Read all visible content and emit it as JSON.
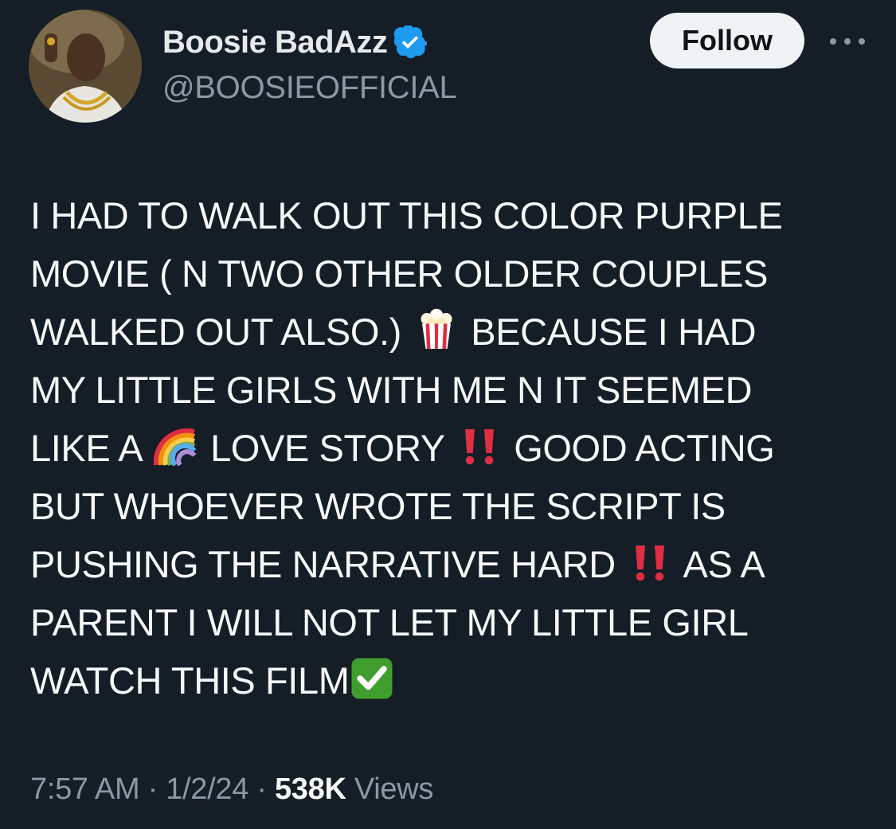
{
  "author": {
    "display_name": "Boosie BadAzz",
    "handle": "@BOOSIEOFFICIAL",
    "verified": true,
    "avatar_icon": "profile-photo"
  },
  "actions": {
    "follow_label": "Follow",
    "more_icon": "ellipsis-icon"
  },
  "tweet": {
    "segments": [
      "I HAD TO WALK OUT THIS COLOR PURPLE",
      "MOVIE ( N TWO OTHER OLDER COUPLES",
      "WALKED OUT ALSO.)",
      "BECAUSE I HAD",
      "MY LITTLE GIRLS WITH ME N IT SEEMED",
      "LIKE A",
      "LOVE STORY",
      "GOOD ACTING",
      "BUT WHOEVER WROTE THE SCRIPT IS",
      "PUSHING THE NARRATIVE HARD",
      "AS A",
      "PARENT I WILL NOT LET MY LITTLE GIRL",
      "WATCH THIS FILM"
    ],
    "emojis": [
      "popcorn",
      "rainbow",
      "double-exclamation",
      "double-exclamation",
      "check-mark-button"
    ]
  },
  "meta": {
    "time": "7:57 AM",
    "separator": "·",
    "date": "1/2/24",
    "views_count": "538K",
    "views_label": "Views"
  },
  "colors": {
    "background": "#151d27",
    "text": "#f7f9f9",
    "secondary_text": "#8b98a5",
    "verified_blue": "#1d9bf0",
    "follow_bg": "#eff3f4"
  }
}
